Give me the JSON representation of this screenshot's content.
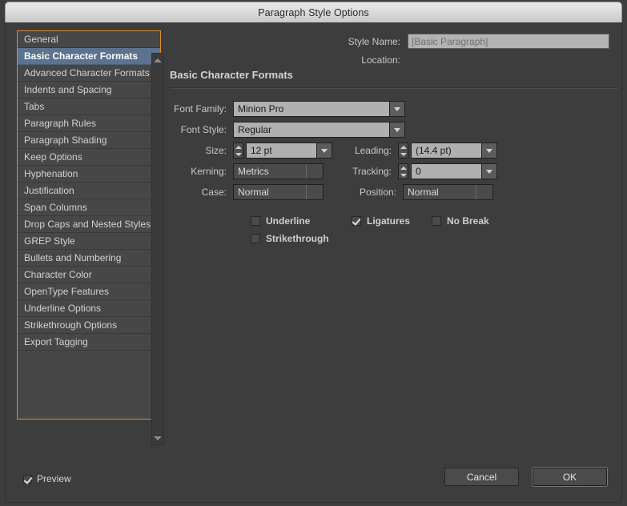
{
  "window": {
    "title": "Paragraph Style Options"
  },
  "sidebar": {
    "items": [
      {
        "label": "General",
        "selected": false
      },
      {
        "label": "Basic Character Formats",
        "selected": true
      },
      {
        "label": "Advanced Character Formats",
        "selected": false
      },
      {
        "label": "Indents and Spacing",
        "selected": false
      },
      {
        "label": "Tabs",
        "selected": false
      },
      {
        "label": "Paragraph Rules",
        "selected": false
      },
      {
        "label": "Paragraph Shading",
        "selected": false
      },
      {
        "label": "Keep Options",
        "selected": false
      },
      {
        "label": "Hyphenation",
        "selected": false
      },
      {
        "label": "Justification",
        "selected": false
      },
      {
        "label": "Span Columns",
        "selected": false
      },
      {
        "label": "Drop Caps and Nested Styles",
        "selected": false
      },
      {
        "label": "GREP Style",
        "selected": false
      },
      {
        "label": "Bullets and Numbering",
        "selected": false
      },
      {
        "label": "Character Color",
        "selected": false
      },
      {
        "label": "OpenType Features",
        "selected": false
      },
      {
        "label": "Underline Options",
        "selected": false
      },
      {
        "label": "Strikethrough Options",
        "selected": false
      },
      {
        "label": "Export Tagging",
        "selected": false
      }
    ],
    "scroll_up_icon": "triangle-up-icon",
    "scroll_down_icon": "triangle-down-icon"
  },
  "header": {
    "style_name_label": "Style Name:",
    "style_name_value": "[Basic Paragraph]",
    "location_label": "Location:",
    "location_value": "",
    "section_title": "Basic Character Formats"
  },
  "fields": {
    "font_family": {
      "label": "Font Family:",
      "value": "Minion Pro"
    },
    "font_style": {
      "label": "Font Style:",
      "value": "Regular"
    },
    "size": {
      "label": "Size:",
      "value": "12 pt"
    },
    "leading": {
      "label": "Leading:",
      "value": "(14.4 pt)"
    },
    "kerning": {
      "label": "Kerning:",
      "value": "Metrics"
    },
    "tracking": {
      "label": "Tracking:",
      "value": "0"
    },
    "case": {
      "label": "Case:",
      "value": "Normal"
    },
    "position": {
      "label": "Position:",
      "value": "Normal"
    }
  },
  "checkboxes": {
    "underline": {
      "label": "Underline",
      "checked": false
    },
    "ligatures": {
      "label": "Ligatures",
      "checked": true
    },
    "no_break": {
      "label": "No Break",
      "checked": false
    },
    "strikethrough": {
      "label": "Strikethrough",
      "checked": false
    }
  },
  "footer": {
    "preview_label": "Preview",
    "preview_checked": true,
    "cancel_label": "Cancel",
    "ok_label": "OK"
  },
  "colors": {
    "dialog_bg": "#3d3d3d",
    "focus_border": "#e08a2e",
    "selection_bg": "#5b738e",
    "field_light": "#b0b0b0"
  }
}
